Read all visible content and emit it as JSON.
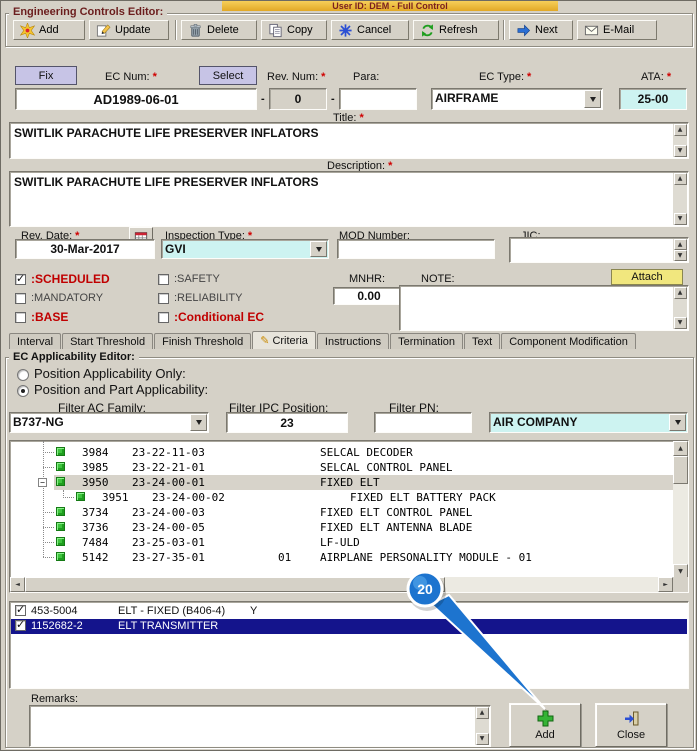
{
  "banner": {
    "text": "User ID: DEM - Full Control"
  },
  "editor": {
    "title": "Engineering Controls Editor:"
  },
  "misc": {
    "req": "*",
    "dash": "-"
  },
  "icons": {
    "criteria_pencil": "✎"
  },
  "toolbar": {
    "add": "Add",
    "update": "Update",
    "delete": "Delete",
    "copy": "Copy",
    "cancel": "Cancel",
    "refresh": "Refresh",
    "next": "Next",
    "email": "E-Mail"
  },
  "hdr": {
    "fix": "Fix",
    "ec_num_label": "EC Num:",
    "select": "Select",
    "rev_num_label": "Rev. Num:",
    "para_label": "Para:",
    "ec_type_label": "EC Type:",
    "ata_label": "ATA:",
    "ec_num": "AD1989-06-01",
    "rev_num": "0",
    "para": "",
    "ec_type": "AIRFRAME",
    "ata": "25-00"
  },
  "title_box": {
    "label": "Title:",
    "value": "SWITLIK PARACHUTE LIFE PRESERVER INFLATORS"
  },
  "desc_box": {
    "label": "Description:",
    "value": "SWITLIK PARACHUTE LIFE PRESERVER INFLATORS"
  },
  "details": {
    "rev_date_label": "Rev. Date:",
    "rev_date": "30-Mar-2017",
    "inspection_label": "Inspection Type:",
    "inspection": "GVI",
    "mod_label": "MOD Number:",
    "mod": "",
    "jic_label": "JIC:",
    "jic": ""
  },
  "flags": {
    "scheduled": ":SCHEDULED",
    "safety": ":SAFETY",
    "mandatory": ":MANDATORY",
    "reliability": ":RELIABILITY",
    "base": ":BASE",
    "conditional": ":Conditional EC",
    "mnhr_label": "MNHR:",
    "mnhr": "0.00",
    "note_label": "NOTE:",
    "note": "",
    "attach": "Attach"
  },
  "tabs": [
    "Interval",
    "Start Threshold",
    "Finish Threshold",
    "Criteria",
    "Instructions",
    "Termination",
    "Text",
    "Component Modification"
  ],
  "active_tab": "Criteria",
  "app": {
    "title": "EC Applicability Editor:",
    "radio_position_only": "Position Applicability Only:",
    "radio_position_part": "Position and Part Applicability:",
    "filter_family_label": "Filter AC Family:",
    "filter_family": "B737-NG",
    "filter_ipc_label": "Filter IPC Position:",
    "filter_ipc": "23",
    "filter_pn_label": "Filter PN:",
    "filter_pn": "",
    "operator": "AIR COMPANY",
    "tree": [
      {
        "id": "3984",
        "ata": "23-22-11-03",
        "pos": "",
        "desc": "SELCAL DECODER"
      },
      {
        "id": "3985",
        "ata": "23-22-21-01",
        "pos": "",
        "desc": "SELCAL CONTROL PANEL"
      },
      {
        "id": "3950",
        "ata": "23-24-00-01",
        "pos": "",
        "desc": "FIXED ELT"
      },
      {
        "id": "3951",
        "ata": "23-24-00-02",
        "pos": "",
        "desc": "FIXED ELT BATTERY PACK"
      },
      {
        "id": "3734",
        "ata": "23-24-00-03",
        "pos": "",
        "desc": "FIXED ELT CONTROL PANEL"
      },
      {
        "id": "3736",
        "ata": "23-24-00-05",
        "pos": "",
        "desc": "FIXED ELT ANTENNA BLADE"
      },
      {
        "id": "7484",
        "ata": "23-25-03-01",
        "pos": "",
        "desc": "LF-ULD"
      },
      {
        "id": "5142",
        "ata": "23-27-35-01",
        "pos": "01",
        "desc": "AIRPLANE PERSONALITY MODULE - 01"
      }
    ],
    "parts": [
      {
        "pn": "453-5004",
        "desc": "ELT - FIXED (B406-4)",
        "flag": "Y",
        "checked": true,
        "selected": false
      },
      {
        "pn": "1152682-2",
        "desc": "ELT TRANSMITTER",
        "flag": "",
        "checked": true,
        "selected": true
      }
    ],
    "remarks_label": "Remarks:",
    "remarks": ""
  },
  "footer": {
    "add": "Add",
    "close": "Close"
  },
  "callout": {
    "number": "20"
  }
}
